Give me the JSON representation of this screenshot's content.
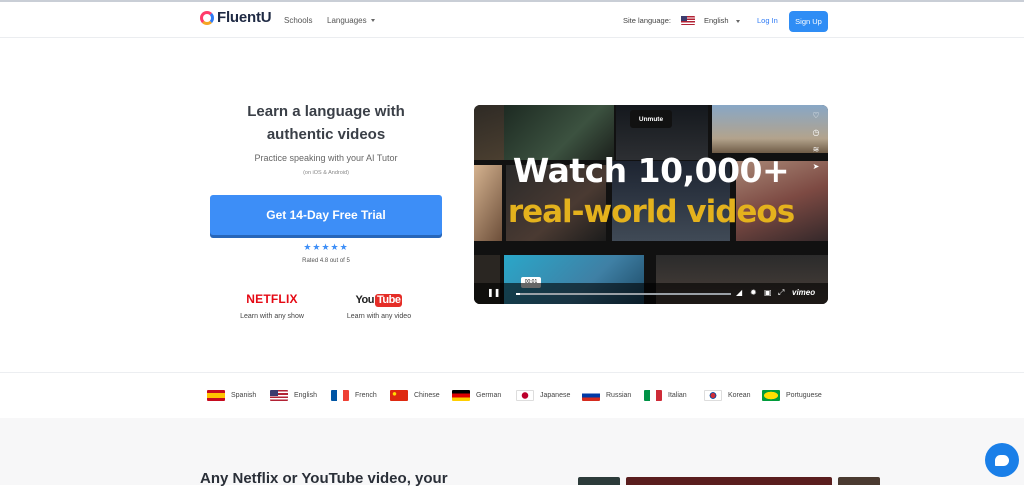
{
  "nav": {
    "logo_text": "FluentU",
    "schools": "Schools",
    "languages": "Languages",
    "site_language_label": "Site language:",
    "site_language": "English",
    "login": "Log In",
    "signup": "Sign Up"
  },
  "hero": {
    "title_line1": "Learn a language with",
    "title_line2": "authentic videos",
    "subtitle": "Practice speaking with your AI Tutor",
    "platforms": "(on iOS & Android)",
    "cta": "Get 14-Day Free Trial",
    "stars": "★★★★★",
    "rating": "Rated 4.8 out of 5",
    "rating_value": 4.8,
    "brands": [
      {
        "logo": "NETFLIX",
        "caption": "Learn with any show"
      },
      {
        "logo_you": "You",
        "logo_tube": "Tube",
        "caption": "Learn with any video"
      }
    ]
  },
  "video": {
    "headline1": "Watch 10,000+",
    "headline2": "real-world videos",
    "unmute": "Unmute",
    "timecode": "00:01",
    "progress": 0.02,
    "provider": "vimeo",
    "icons": [
      "heart-icon",
      "clock-icon",
      "layers-icon",
      "send-icon",
      "pause-icon",
      "volume-icon",
      "settings-icon",
      "pip-icon",
      "fullscreen-icon"
    ]
  },
  "languages": [
    {
      "name": "Spanish",
      "colors": [
        "#c60b1e",
        "#ffc400"
      ]
    },
    {
      "name": "English",
      "colors": [
        "#b22234",
        "#ffffff",
        "#3c3b6e"
      ]
    },
    {
      "name": "French",
      "colors": [
        "#0055a4",
        "#ffffff",
        "#ef4135"
      ]
    },
    {
      "name": "Chinese",
      "colors": [
        "#de2910",
        "#ffde00"
      ]
    },
    {
      "name": "German",
      "colors": [
        "#000000",
        "#dd0000",
        "#ffce00"
      ]
    },
    {
      "name": "Japanese",
      "colors": [
        "#ffffff",
        "#bc002d"
      ]
    },
    {
      "name": "Russian",
      "colors": [
        "#ffffff",
        "#0039a6",
        "#d52b1e"
      ]
    },
    {
      "name": "Italian",
      "colors": [
        "#009246",
        "#ffffff",
        "#ce2b37"
      ]
    },
    {
      "name": "Korean",
      "colors": [
        "#ffffff",
        "#cd2e3a",
        "#0047a0"
      ]
    },
    {
      "name": "Portuguese",
      "colors": [
        "#009c3b",
        "#ffdf00"
      ]
    }
  ],
  "bottom": {
    "title": "Any Netflix or YouTube video, your"
  },
  "colors": {
    "accent": "#3d8ef7",
    "netflix": "#e50914",
    "video_headline": "#e4b21d"
  }
}
